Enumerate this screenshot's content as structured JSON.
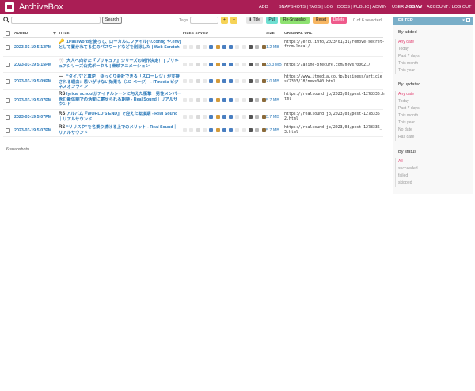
{
  "header": {
    "brand": "ArchiveBox",
    "add": "ADD",
    "nav_links": "SNAPSHOTS | TAGS | LOG",
    "docs_links": "DOCS | PUBLIC | ADMIN",
    "user_prefix": "USER",
    "username": "JIGSAW",
    "account_links": "ACCOUNT / LOG OUT",
    "bg_color": "#aa1e55"
  },
  "toolbar": {
    "search_placeholder": "",
    "search_button": "Search",
    "tags_label": "Tags",
    "add_tag": "+",
    "remove_tag": "–",
    "title_button": "Title",
    "pull_button": "Pull",
    "resnapshot_button": "Re-Snapshot",
    "reset_button": "Reset",
    "delete_button": "Delete",
    "selected_count": "0 of 6 selected"
  },
  "table": {
    "headers": {
      "added": "ADDED",
      "title": "TITLE",
      "files": "FILES SAVED",
      "size": "SIZE",
      "url": "ORIGINAL URL"
    },
    "rows": [
      {
        "date": "2023-03-19 5:13PM",
        "favicon": "🔑",
        "title": "1Passwordを使って、ローカルにファイル(~/.config や.env)として置かれてる生のパスワードなどを削除した | Web Scratch",
        "size": "1.2 MB",
        "url": "https://efcl.info/2023/01/31/remove-secret-from-local/"
      },
      {
        "date": "2023-03-19 5:15PM",
        "favicon": "🎌",
        "title": "大人へ向けた『プリキュア』シリーズの制作決定！ | プリキュアシリーズ公式ポータル | 東映アニメーション",
        "size": "33.3 MB",
        "url": "https://anime-precure.com/news/00021/"
      },
      {
        "date": "2023-03-19 5:09PM",
        "favicon": "—",
        "title": "“タイパ”と真逆　ゆっくり会計できる「スローレジ」が支持される理由：思いがけない効果も（1/2 ページ） - ITmedia ビジネスオンライン",
        "size": "2.0 MB",
        "url": "https://www.itmedia.co.jp/business/articles/2303/18/news040.html"
      },
      {
        "date": "2023-03-19 5:07PM",
        "favicon": "RS",
        "title": "lyrical schoolがアイドルシーンに与えた衝撃　男性メンバー含む新体制での活動に寄せられる期待 - Real Sound｜リアルサウンド",
        "size": "5.7 MB",
        "url": "https://realsound.jp/2023/03/post-1278336.html"
      },
      {
        "date": "2023-03-19 5:07PM",
        "favicon": "RS",
        "title": "アルバム『WORLD’S END』で迎えた転換期 - Real Sound｜リアルサウンド",
        "size": "5.7 MB",
        "url": "https://realsound.jp/2023/03/post-1278336_2.html"
      },
      {
        "date": "2023-03-19 5:07PM",
        "favicon": "RS",
        "title": "“リリスク”を名乗り続ける上でのメリット - Real Sound｜リアルサウンド",
        "size": "5.7 MB",
        "url": "https://realsound.jp/2023/03/post-1278336_3.html"
      }
    ]
  },
  "snapshot_count": "6 snapshots",
  "filter": {
    "title": "FILTER",
    "close": "×",
    "by_added": {
      "title": "By added",
      "items": [
        "Any date",
        "Today",
        "Past 7 days",
        "This month",
        "This year"
      ]
    },
    "by_updated": {
      "title": "By updated",
      "items": [
        "Any date",
        "Today",
        "Past 7 days",
        "This month",
        "This year",
        "No date",
        "Has date"
      ]
    },
    "by_status": {
      "title": "By status",
      "items": [
        "All",
        "succeeded",
        "failed",
        "skipped"
      ]
    }
  }
}
